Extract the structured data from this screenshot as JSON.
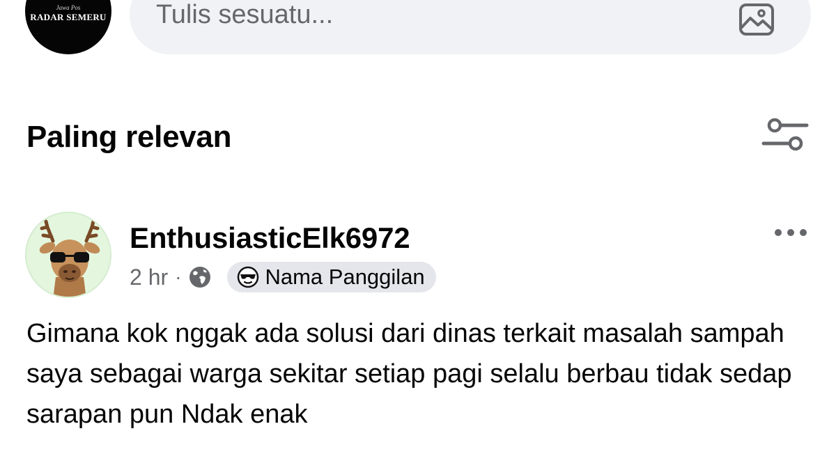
{
  "page": {
    "avatar_brand_small": "Jawa Pos",
    "avatar_brand": "RADAR SEMERU"
  },
  "composer": {
    "placeholder": "Tulis sesuatu..."
  },
  "sort": {
    "label": "Paling relevan"
  },
  "comment": {
    "author": "EnthusiasticElk6972",
    "time": "2 hr",
    "separator": "·",
    "badge_label": "Nama Panggilan",
    "text": "Gimana kok nggak ada solusi dari dinas terkait masalah sampah saya sebagai warga sekitar setiap pagi selalu berbau tidak sedap sarapan pun Ndak enak"
  },
  "icons": {
    "photo": "photo-icon",
    "filter": "filter-sliders-icon",
    "more": "more-options-icon",
    "globe": "globe-icon",
    "sunglasses": "sunglasses-emoji-icon"
  }
}
